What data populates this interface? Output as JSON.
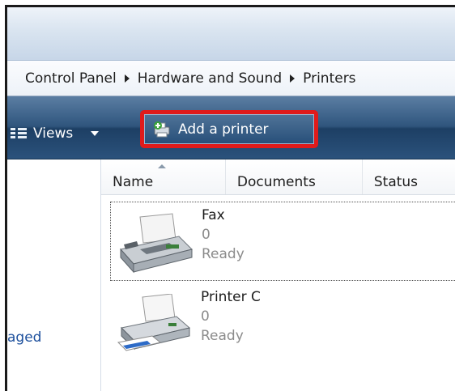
{
  "breadcrumb": [
    "Control Panel",
    "Hardware and Sound",
    "Printers"
  ],
  "toolbar": {
    "views_label": "Views",
    "add_printer_label": "Add a printer"
  },
  "columns": [
    "Name",
    "Documents",
    "Status"
  ],
  "nav": {
    "partial_link": "aged"
  },
  "items": [
    {
      "name": "Fax",
      "documents": "0",
      "status": "Ready",
      "icon": "fax-icon"
    },
    {
      "name": "Printer C",
      "documents": "0",
      "status": "Ready",
      "icon": "printer-icon"
    }
  ],
  "colors": {
    "highlight": "#e01b1b",
    "toolbar": "#2f557d",
    "link": "#1c4f9c"
  }
}
